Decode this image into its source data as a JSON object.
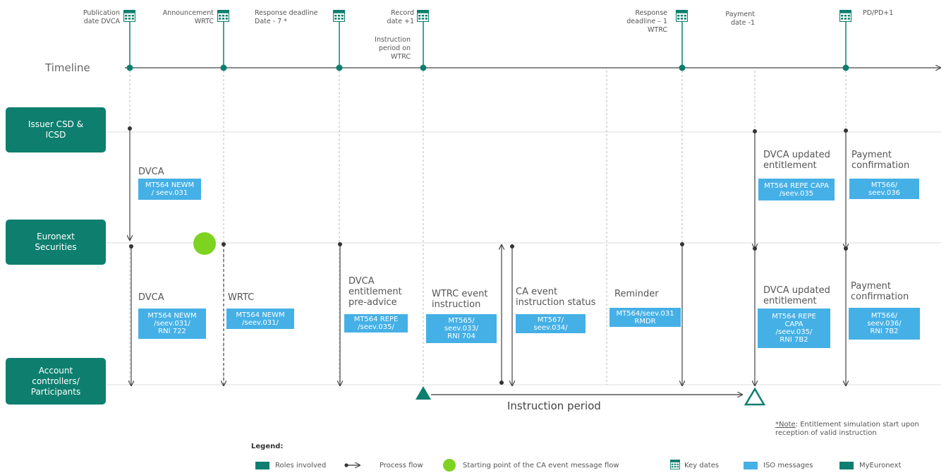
{
  "timeline": {
    "label": "Timeline",
    "key_dates": [
      {
        "id": "publication",
        "label": "Publication\ndate DVCA"
      },
      {
        "id": "announcement",
        "label": "Announcement\nWRTC"
      },
      {
        "id": "response-deadline",
        "label": "Response deadline\nDate - 7 *"
      },
      {
        "id": "record",
        "label": "Record\ndate +1"
      },
      {
        "id": "instruction-period",
        "label": "Instruction\nperiod on\nWTRC"
      },
      {
        "id": "response-deadline-wtrc",
        "label": "Response\ndeadline – 1\nWTRC"
      },
      {
        "id": "payment",
        "label": "Payment\ndate -1"
      },
      {
        "id": "pd",
        "label": "PD/PD+1"
      }
    ]
  },
  "roles": [
    {
      "id": "issuer",
      "label": "Issuer CSD &\nICSD"
    },
    {
      "id": "euronext",
      "label": "Euronext\nSecurities"
    },
    {
      "id": "participants",
      "label": "Account\ncontrollers/\nParticipants"
    }
  ],
  "upper_messages": [
    {
      "id": "dvca-upper",
      "title": "DVCA",
      "iso": "MT564 NEWM\n/ seev.031"
    },
    {
      "id": "dvca-updated-upper",
      "title": "DVCA updated\nentitlement",
      "iso": "MT564 REPE CAPA\n/seev.035"
    },
    {
      "id": "payment-upper",
      "title": "Payment\nconfirmation",
      "iso": "MT566/\nseev.036"
    }
  ],
  "lower_messages": [
    {
      "id": "dvca-lower",
      "title": "DVCA",
      "iso": "MT564 NEWM\n/seev.031/\nRNI 722"
    },
    {
      "id": "wrtc-lower",
      "title": "WRTC",
      "iso": "MT564 NEWM\n/seev.031/"
    },
    {
      "id": "dvca-pre-advice",
      "title": "DVCA\nentitlement\npre-advice",
      "iso": "MT564 REPE\n/seev.035/"
    },
    {
      "id": "wtrc-event",
      "title": "WTRC event\ninstruction",
      "iso": "MT565/\nseev.033/\nRNI 704"
    },
    {
      "id": "ca-status",
      "title": "CA event\ninstruction status",
      "iso": "MT567/\nseev.034/"
    },
    {
      "id": "reminder",
      "title": "Reminder",
      "iso": "MT564/seev.031\nRMDR"
    },
    {
      "id": "dvca-updated-lower",
      "title": "DVCA updated\nentitlement",
      "iso": "MT564 REPE\nCAPA\n/seev.035/\nRNI 7B2"
    },
    {
      "id": "payment-lower",
      "title": "Payment\nconfirmation",
      "iso": "MT566/\nseev.036/\nRNI 7B2"
    }
  ],
  "instruction_period_label": "Instruction period",
  "note": {
    "prefix": "*Note",
    "text": ": Entitlement simulation start upon reception of valid instruction"
  },
  "legend": {
    "title": "Legend:",
    "roles": "Roles involved",
    "process": "Process flow",
    "start": "Starting point of the CA event message flow",
    "key_dates": "Key dates",
    "iso": "ISO messages",
    "myeuronext": "MyEuronext"
  },
  "colors": {
    "teal": "#0e7f6f",
    "iso_blue": "#45b0e6",
    "start_green": "#7ed321",
    "line": "#444444",
    "grid": "#dddddd"
  },
  "icons": {
    "key_date": "calendar-icon",
    "start": "green-circle"
  }
}
